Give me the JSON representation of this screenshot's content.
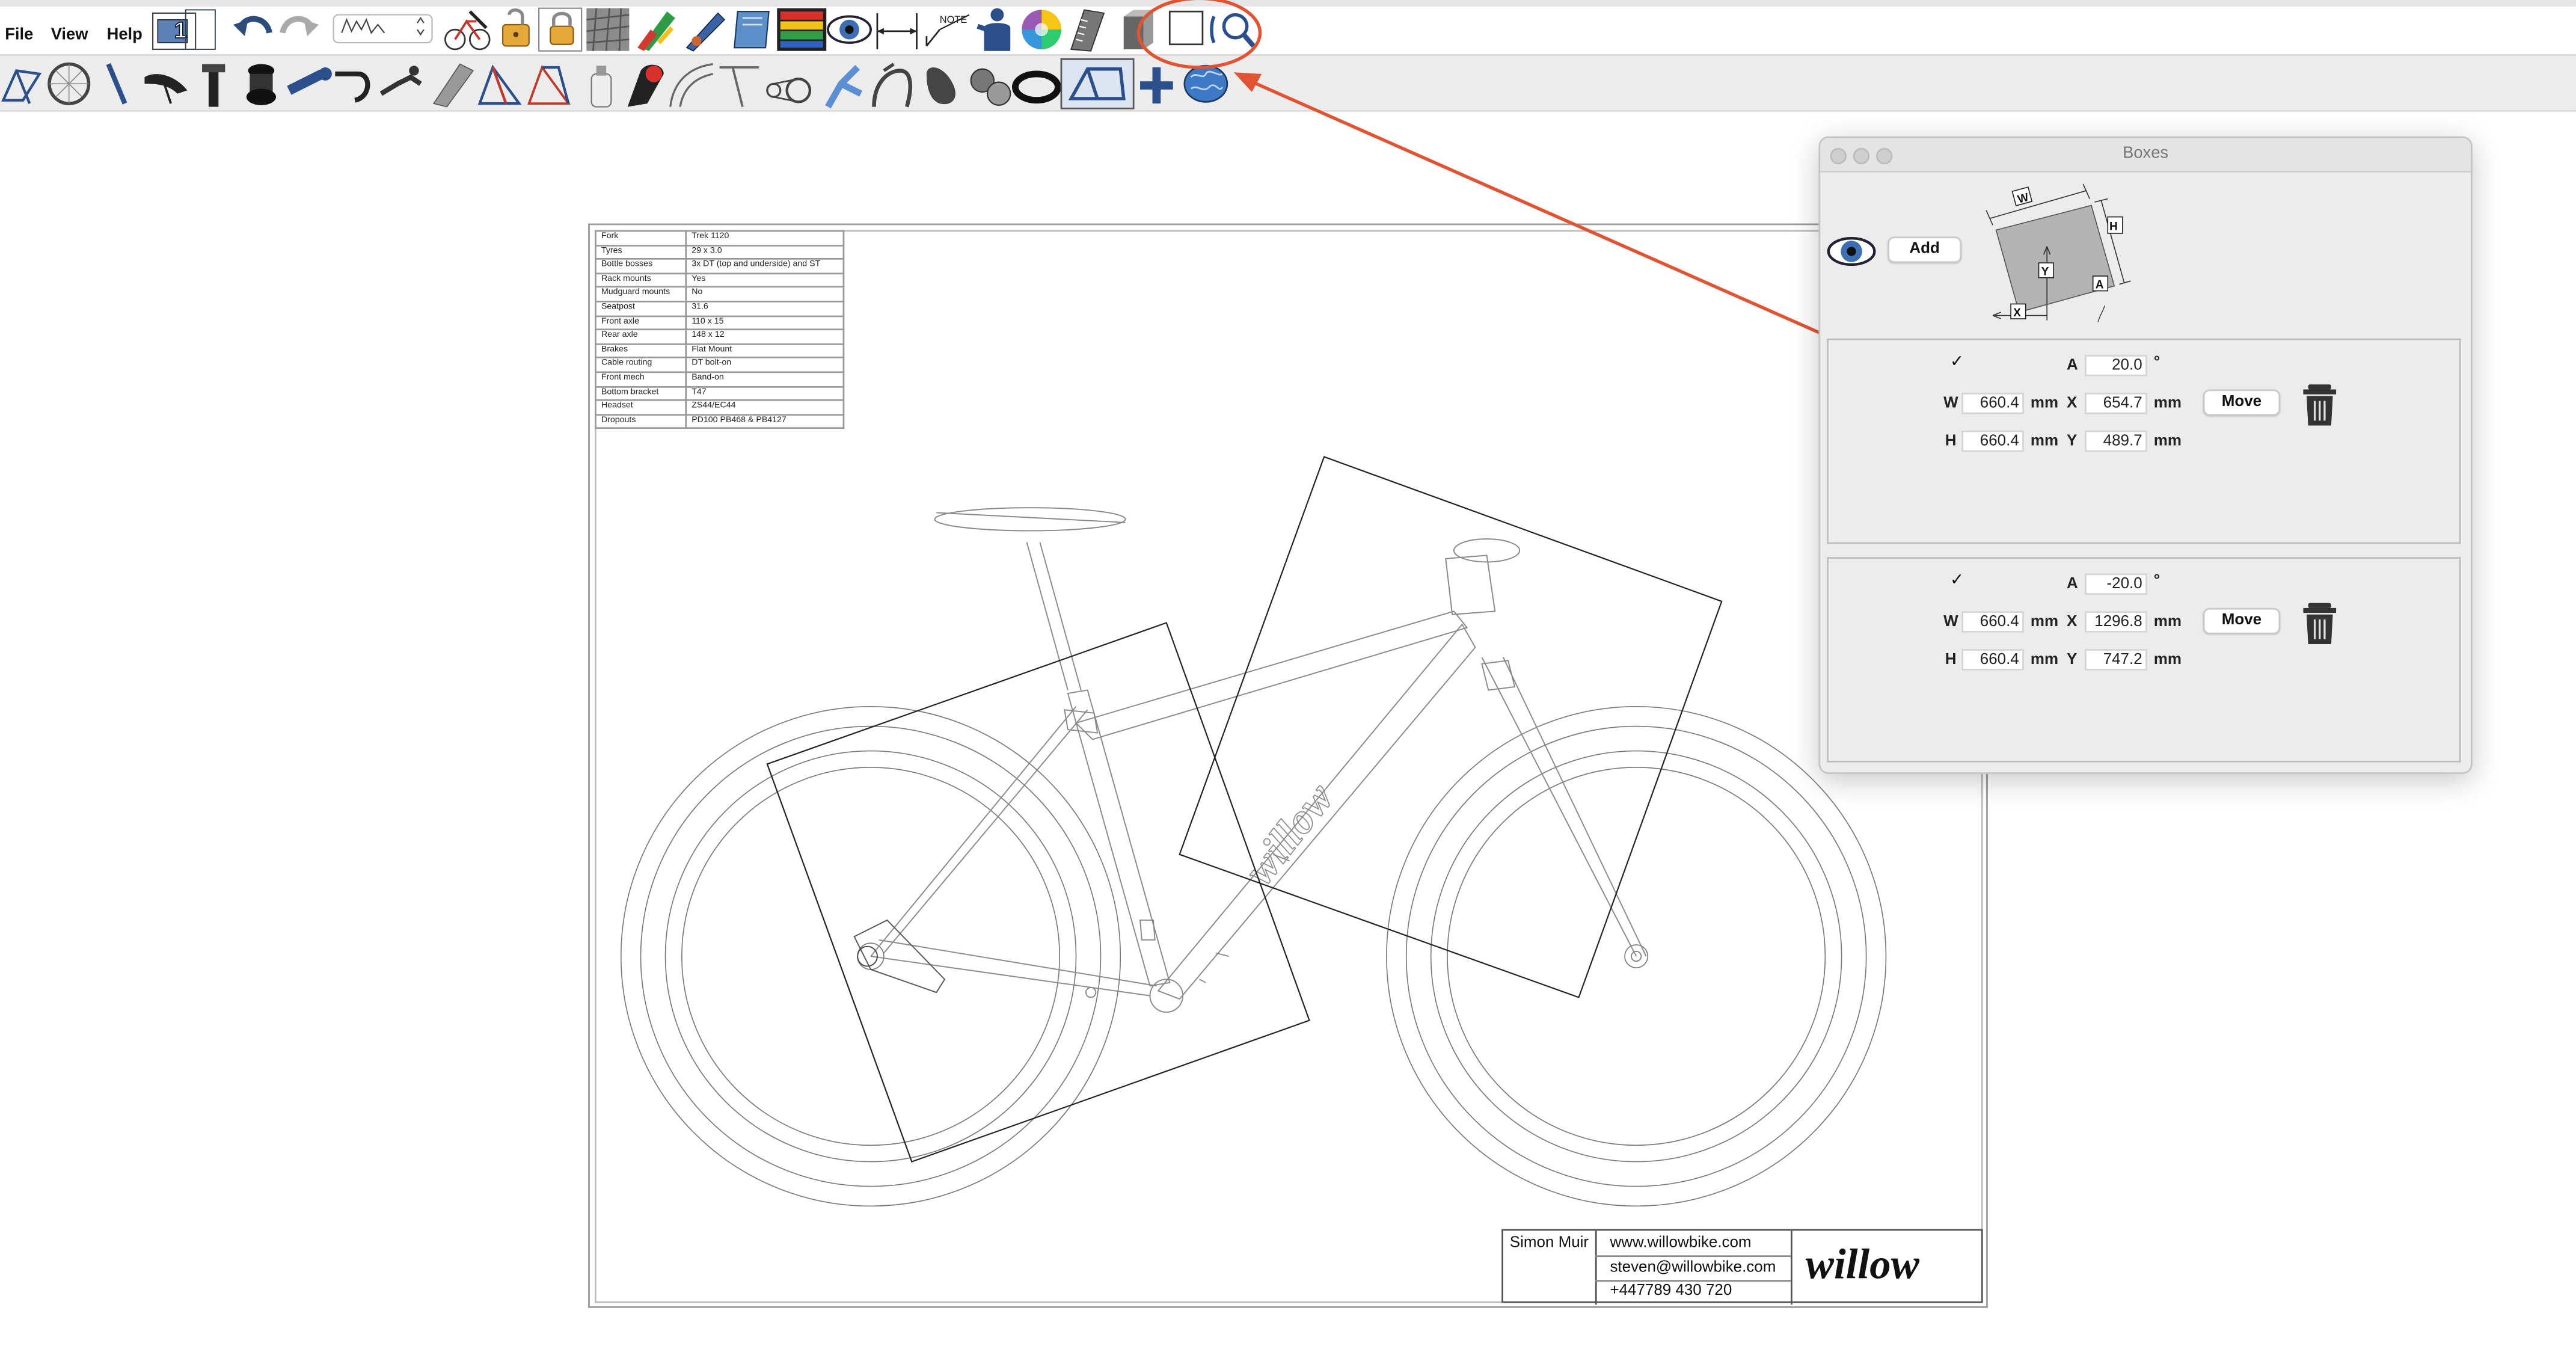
{
  "menu": {
    "file": "File",
    "view": "View",
    "help": "Help"
  },
  "toolbar": {
    "top_icons": [
      "stack-icon",
      "undo-icon",
      "redo-icon",
      "profile-dropdown",
      "frame-edit-icon",
      "lock-open-icon",
      "lock-icon",
      "grayscale-texture-icon",
      "fill-icon",
      "pencil-icon",
      "book-icon",
      "color-stripes-icon",
      "eye-icon",
      "dimension-icon",
      "note-icon",
      "rider-icon",
      "color-wheel-icon",
      "ruler-icon",
      "shape-icon",
      "box-tool-icon",
      "zoom-icon"
    ],
    "note_label": "NOTE",
    "bottom_icons": [
      "frame-icon",
      "wheel-icon",
      "fork-icon",
      "saddle-icon",
      "seatpost-icon",
      "headset-icon",
      "stem-icon",
      "handlebar-icon",
      "rider-icon",
      "tube-icon",
      "frame-red-icon",
      "frame-blue-icon",
      "bottle-icon",
      "tyre-icon",
      "arc-icon",
      "angle-icon",
      "drivetrain-icon",
      "dropout-icon",
      "brake-icon",
      "shoe-icon",
      "bearing-icon",
      "ring-icon",
      "frame-template-icon",
      "plus-icon",
      "brain-icon"
    ]
  },
  "annotation": {
    "color": "#E05433"
  },
  "spec_table": [
    {
      "key": "Fork",
      "value": "Trek 1120"
    },
    {
      "key": "Tyres",
      "value": "29 x 3.0"
    },
    {
      "key": "Bottle bosses",
      "value": "3x DT (top and underside) and ST"
    },
    {
      "key": "Rack mounts",
      "value": "Yes"
    },
    {
      "key": "Mudguard mounts",
      "value": "No"
    },
    {
      "key": "Seatpost",
      "value": "31.6"
    },
    {
      "key": "Front axle",
      "value": "110 x 15"
    },
    {
      "key": "Rear axle",
      "value": "148 x 12"
    },
    {
      "key": "Brakes",
      "value": "Flat Mount"
    },
    {
      "key": "Cable routing",
      "value": "DT bolt-on"
    },
    {
      "key": "Front mech",
      "value": "Band-on"
    },
    {
      "key": "Bottom bracket",
      "value": "T47"
    },
    {
      "key": "Headset",
      "value": "ZS44/EC44"
    },
    {
      "key": "Dropouts",
      "value": "PD100 PB468 & PB4127"
    }
  ],
  "title_block": {
    "name": "Simon Muir",
    "web": "www.willowbike.com",
    "email": "steven@willowbike.com",
    "phone": "+447789 430 720",
    "logo": "willow"
  },
  "frame_decal": "willow",
  "boxes_window": {
    "title": "Boxes",
    "add_label": "Add",
    "diagram_labels": {
      "w": "W",
      "h": "H",
      "y": "Y",
      "x": "X",
      "a": "A"
    },
    "boxes": [
      {
        "enabled": true,
        "check": "✓",
        "a": "20.0",
        "w": "660.4",
        "h": "660.4",
        "x": "654.7",
        "y": "489.7",
        "deg": "°",
        "unit": "mm",
        "move_label": "Move"
      },
      {
        "enabled": true,
        "check": "✓",
        "a": "-20.0",
        "w": "660.4",
        "h": "660.4",
        "x": "1296.8",
        "y": "747.2",
        "deg": "°",
        "unit": "mm",
        "move_label": "Move"
      }
    ],
    "field_labels": {
      "a": "A",
      "w": "W",
      "h": "H",
      "x": "X",
      "y": "Y"
    }
  }
}
